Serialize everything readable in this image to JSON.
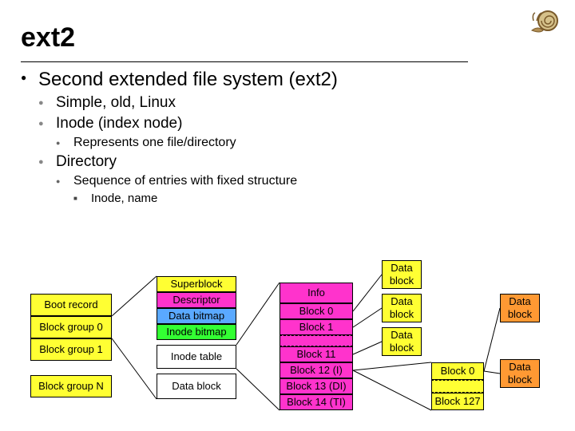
{
  "title": "ext2",
  "outline": {
    "main": "Second extended file system (ext2)",
    "sub": [
      "Simple, old, Linux",
      "Inode (index node)"
    ],
    "inode_detail": "Represents one file/directory",
    "dir": "Directory",
    "dir_detail": "Sequence of entries with fixed structure",
    "dir_leaf": "Inode, name"
  },
  "leftStack": [
    "Boot record",
    "Block group 0",
    "Block group 1",
    "Block group N"
  ],
  "midStack": [
    "Superblock",
    "Descriptor",
    "Data bitmap",
    "Inode bitmap",
    "Inode table",
    "Data block"
  ],
  "rightUpper": [
    "Info",
    "Block 0",
    "Block 1"
  ],
  "rightLower": [
    "Block 11",
    "Block 12 (I)",
    "Block 13 (DI)",
    "Block 14 (TI)"
  ],
  "dblk": "Data block",
  "idxUpper": "Block 0",
  "idxLower": "Block 127"
}
